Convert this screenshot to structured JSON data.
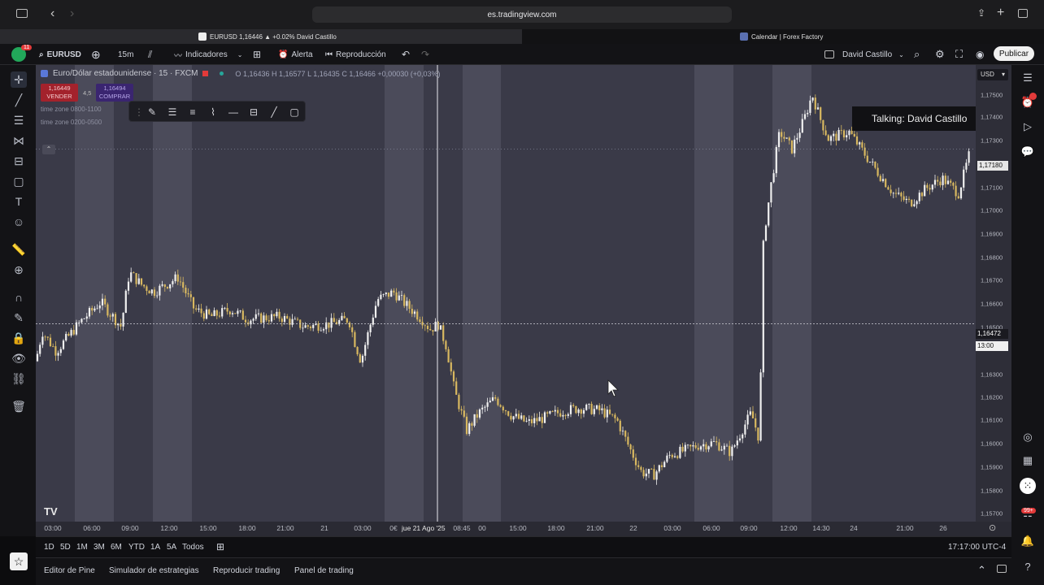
{
  "browser": {
    "url": "es.tradingview.com",
    "tabs": [
      {
        "title": "EURUSD 1,16446 ▲ +0.02% David Castillo",
        "active": true
      },
      {
        "title": "Calendar | Forex Factory",
        "active": false
      }
    ]
  },
  "toolbar": {
    "avatar_badge": "11",
    "symbol": "EURUSD",
    "interval": "15m",
    "indicators": "Indicadores",
    "alert": "Alerta",
    "replay": "Reproducción",
    "user": "David Castillo",
    "publish": "Publicar"
  },
  "legend": {
    "title": "Euro/Dólar estadounidense · 15 · FXCM",
    "open_label": "O",
    "open": "1,16436",
    "high_label": "H",
    "high": "1,16577",
    "low_label": "L",
    "low": "1,16435",
    "close_label": "C",
    "close": "1,16466",
    "change": "+0,00030 (+0,03%)",
    "sell_price": "1,16449",
    "sell_label": "VENDER",
    "spread": "4,5",
    "buy_price": "1,16494",
    "buy_label": "COMPRAR",
    "session_1": "time zone 0800-1100",
    "session_2": "time zone 0200-0500"
  },
  "overlay": {
    "talking": "Talking: David Castillo"
  },
  "price_axis": {
    "currency": "USD",
    "ticks": [
      "1,17500",
      "1,17400",
      "1,17300",
      "1,17100",
      "1,17000",
      "1,16900",
      "1,16800",
      "1,16700",
      "1,16600",
      "1,16500",
      "1,16300",
      "1,16200",
      "1,16100",
      "1,16000",
      "1,15900",
      "1,15800",
      "1,15700"
    ],
    "last_price": "1,17180",
    "crosshair_price": "1,16472",
    "crosshair_time": "13:00"
  },
  "time_axis": {
    "ticks": [
      "03:00",
      "06:00",
      "09:00",
      "12:00",
      "15:00",
      "18:00",
      "21:00",
      "21",
      "03:00",
      "0€",
      "08:45",
      "00",
      "15:00",
      "18:00",
      "21:00",
      "22",
      "03:00",
      "06:00",
      "09:00",
      "12:00",
      "14:30",
      "24",
      "21:00",
      "26"
    ],
    "crosshair_date": "jue 21 Ago '25"
  },
  "range_bar": {
    "ranges": [
      "1D",
      "5D",
      "1M",
      "3M",
      "6M",
      "YTD",
      "1A",
      "5A",
      "Todos"
    ],
    "clock": "17:17:00 UTC-4"
  },
  "panel_bar": {
    "tabs": [
      "Editor de Pine",
      "Simulador de estrategias",
      "Reproducir trading",
      "Panel de trading"
    ]
  },
  "right_bar": {
    "notif_badge": "99+"
  },
  "colors": {
    "chart_bg": "#3a3a48",
    "session_shade": "#5a5a6a",
    "candle_up": "#f0f0f0",
    "candle_down": "#d8b860",
    "sell": "#c2303a",
    "buy": "#4a2d8a",
    "accent_green": "#22a75a"
  },
  "chart_data": {
    "type": "candlestick",
    "symbol": "EURUSD",
    "interval": "15m",
    "ylim": [
      1.1567,
      1.1752
    ],
    "series_path": [
      [
        0,
        1.1632
      ],
      [
        8,
        1.1644
      ],
      [
        25,
        1.1636
      ],
      [
        55,
        1.1648
      ],
      [
        80,
        1.1656
      ],
      [
        105,
        1.1646
      ],
      [
        115,
        1.1668
      ],
      [
        130,
        1.1663
      ],
      [
        145,
        1.166
      ],
      [
        160,
        1.1663
      ],
      [
        175,
        1.1666
      ],
      [
        195,
        1.1653
      ],
      [
        215,
        1.165
      ],
      [
        240,
        1.1653
      ],
      [
        260,
        1.1649
      ],
      [
        300,
        1.165
      ],
      [
        330,
        1.1646
      ],
      [
        360,
        1.1647
      ],
      [
        385,
        1.1649
      ],
      [
        392,
        1.164
      ],
      [
        400,
        1.1632
      ],
      [
        410,
        1.1645
      ],
      [
        420,
        1.1657
      ],
      [
        440,
        1.166
      ],
      [
        455,
        1.1655
      ],
      [
        475,
        1.1649
      ],
      [
        485,
        1.1645
      ],
      [
        495,
        1.1647
      ],
      [
        505,
        1.1638
      ],
      [
        515,
        1.162
      ],
      [
        530,
        1.1604
      ],
      [
        545,
        1.1611
      ],
      [
        565,
        1.1617
      ],
      [
        585,
        1.161
      ],
      [
        605,
        1.1607
      ],
      [
        625,
        1.1609
      ],
      [
        650,
        1.1612
      ],
      [
        670,
        1.1613
      ],
      [
        695,
        1.1612
      ],
      [
        715,
        1.1608
      ],
      [
        730,
        1.1597
      ],
      [
        745,
        1.1587
      ],
      [
        760,
        1.1586
      ],
      [
        780,
        1.1594
      ],
      [
        800,
        1.1596
      ],
      [
        815,
        1.1598
      ],
      [
        835,
        1.1599
      ],
      [
        855,
        1.1595
      ],
      [
        870,
        1.1605
      ],
      [
        880,
        1.1611
      ],
      [
        890,
        1.16
      ],
      [
        895,
        1.1682
      ],
      [
        905,
        1.1705
      ],
      [
        915,
        1.1725
      ],
      [
        930,
        1.1718
      ],
      [
        945,
        1.173
      ],
      [
        955,
        1.174
      ],
      [
        965,
        1.173
      ],
      [
        975,
        1.1722
      ],
      [
        1000,
        1.1725
      ],
      [
        1015,
        1.1718
      ],
      [
        1030,
        1.1711
      ],
      [
        1055,
        1.17
      ],
      [
        1075,
        1.1696
      ],
      [
        1095,
        1.1702
      ],
      [
        1115,
        1.1706
      ],
      [
        1135,
        1.17
      ],
      [
        1150,
        1.1718
      ]
    ],
    "sessions": [
      [
        48,
        96
      ],
      [
        144,
        192
      ],
      [
        429,
        477
      ],
      [
        525,
        572
      ],
      [
        810,
        858
      ],
      [
        906,
        954
      ]
    ],
    "crosshair": {
      "x": 538,
      "price": 1.16472
    }
  }
}
